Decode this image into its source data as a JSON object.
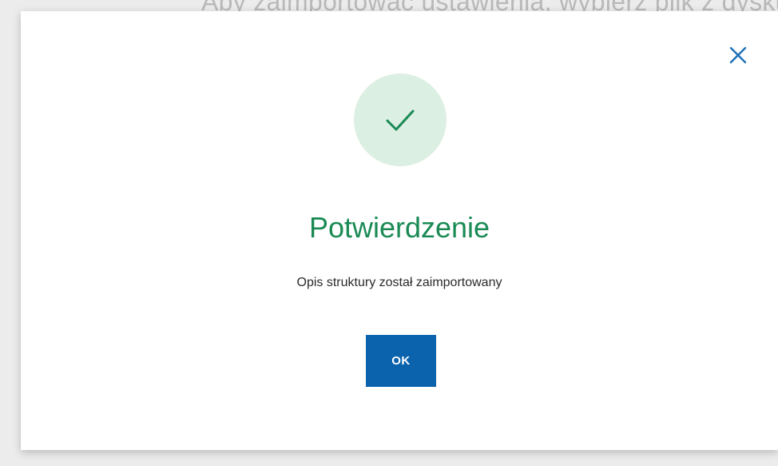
{
  "background": {
    "text": "Aby zaimportować ustawienia, wybierz plik z dysku"
  },
  "dialog": {
    "close_icon": "close-icon",
    "success_icon": "checkmark-icon",
    "title": "Potwierdzenie",
    "message": "Opis struktury został zaimportowany",
    "ok_label": "OK"
  },
  "colors": {
    "title": "#1a8a55",
    "icon_circle": "#dcefe3",
    "checkmark": "#1a8a55",
    "primary_button": "#0b62ad",
    "close_icon": "#1c6fb8"
  }
}
